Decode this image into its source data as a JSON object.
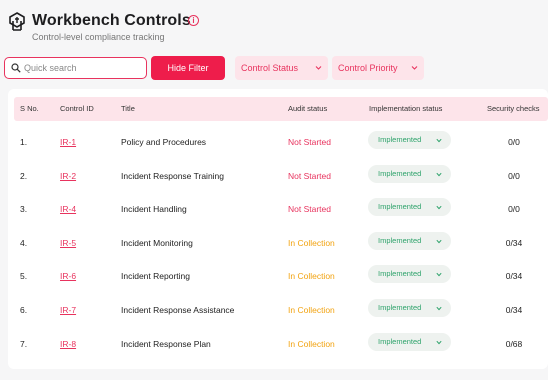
{
  "header": {
    "title": "Workbench Controls",
    "subtitle": "Control-level compliance tracking",
    "info_glyph": "i"
  },
  "toolbar": {
    "search_placeholder": "Quick search",
    "hide_filter_label": "Hide Filter",
    "control_status_label": "Control Status",
    "control_priority_label": "Control Priority"
  },
  "table": {
    "columns": {
      "sno": "S No.",
      "control_id": "Control ID",
      "title": "Title",
      "audit_status": "Audit status",
      "implementation_status": "Implementation status",
      "security_checks": "Security checks"
    },
    "rows": [
      {
        "sno": "1.",
        "control_id": "IR-1",
        "title": "Policy and Procedures",
        "audit_status": "Not Started",
        "audit_kind": "notstarted",
        "implementation_status": "Implemented",
        "security_checks": "0/0"
      },
      {
        "sno": "2.",
        "control_id": "IR-2",
        "title": "Incident Response Training",
        "audit_status": "Not Started",
        "audit_kind": "notstarted",
        "implementation_status": "Implemented",
        "security_checks": "0/0"
      },
      {
        "sno": "3.",
        "control_id": "IR-4",
        "title": "Incident Handling",
        "audit_status": "Not Started",
        "audit_kind": "notstarted",
        "implementation_status": "Implemented",
        "security_checks": "0/0"
      },
      {
        "sno": "4.",
        "control_id": "IR-5",
        "title": "Incident Monitoring",
        "audit_status": "In Collection",
        "audit_kind": "collection",
        "implementation_status": "Implemented",
        "security_checks": "0/34"
      },
      {
        "sno": "5.",
        "control_id": "IR-6",
        "title": "Incident Reporting",
        "audit_status": "In Collection",
        "audit_kind": "collection",
        "implementation_status": "Implemented",
        "security_checks": "0/34"
      },
      {
        "sno": "6.",
        "control_id": "IR-7",
        "title": "Incident Response Assistance",
        "audit_status": "In Collection",
        "audit_kind": "collection",
        "implementation_status": "Implemented",
        "security_checks": "0/34"
      },
      {
        "sno": "7.",
        "control_id": "IR-8",
        "title": "Incident Response Plan",
        "audit_status": "In Collection",
        "audit_kind": "collection",
        "implementation_status": "Implemented",
        "security_checks": "0/68"
      }
    ]
  },
  "colors": {
    "accent": "#ee1d4b",
    "accent_soft": "#fde4ea",
    "not_started": "#e8335e",
    "in_collection": "#f2a311",
    "implemented": "#2ea36b"
  }
}
